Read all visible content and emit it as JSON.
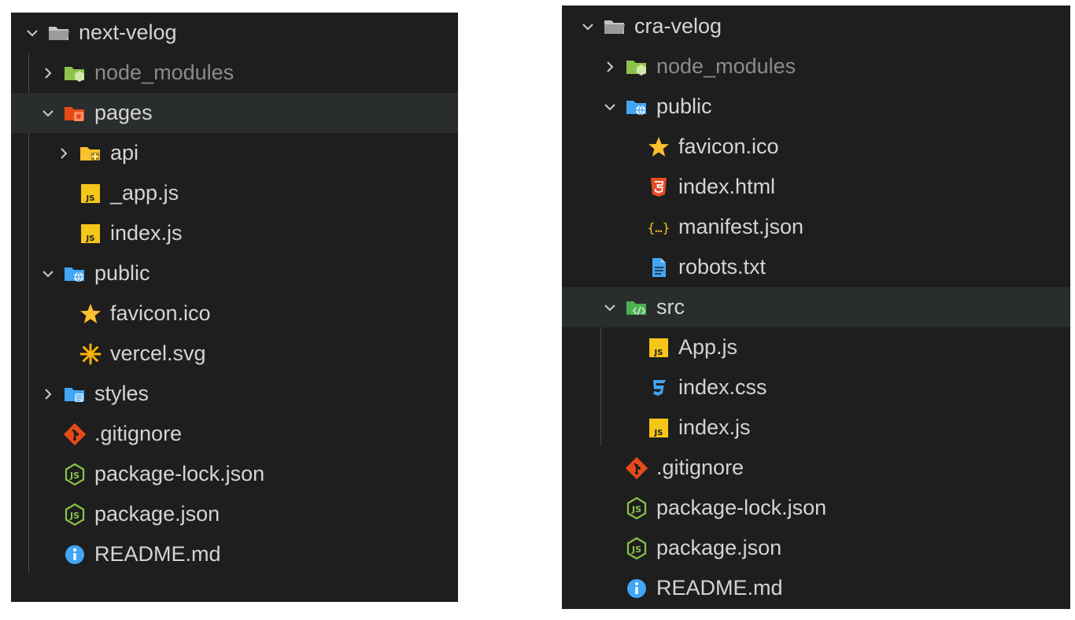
{
  "left": {
    "items": [
      {
        "label": "next-velog",
        "depth": 0,
        "twisty": "open",
        "icon": "folder-open-icon"
      },
      {
        "label": "node_modules",
        "depth": 1,
        "twisty": "closed",
        "icon": "node-folder-icon",
        "dim": true
      },
      {
        "label": "pages",
        "depth": 1,
        "twisty": "open",
        "icon": "pages-folder-icon",
        "selected": true
      },
      {
        "label": "api",
        "depth": 2,
        "twisty": "closed",
        "icon": "api-folder-icon"
      },
      {
        "label": "_app.js",
        "depth": 2,
        "twisty": "none",
        "icon": "js-file-icon"
      },
      {
        "label": "index.js",
        "depth": 2,
        "twisty": "none",
        "icon": "js-file-icon"
      },
      {
        "label": "public",
        "depth": 1,
        "twisty": "open",
        "icon": "public-folder-icon"
      },
      {
        "label": "favicon.ico",
        "depth": 2,
        "twisty": "none",
        "icon": "star-icon"
      },
      {
        "label": "vercel.svg",
        "depth": 2,
        "twisty": "none",
        "icon": "svg-file-icon"
      },
      {
        "label": "styles",
        "depth": 1,
        "twisty": "closed",
        "icon": "styles-folder-icon"
      },
      {
        "label": ".gitignore",
        "depth": 1,
        "twisty": "none",
        "icon": "git-icon"
      },
      {
        "label": "package-lock.json",
        "depth": 1,
        "twisty": "none",
        "icon": "node-js-icon"
      },
      {
        "label": "package.json",
        "depth": 1,
        "twisty": "none",
        "icon": "node-js-icon"
      },
      {
        "label": "README.md",
        "depth": 1,
        "twisty": "none",
        "icon": "info-icon"
      }
    ]
  },
  "right": {
    "items": [
      {
        "label": "cra-velog",
        "depth": 0,
        "twisty": "open",
        "icon": "folder-open-icon"
      },
      {
        "label": "node_modules",
        "depth": 1,
        "twisty": "closed",
        "icon": "node-folder-icon",
        "dim": true
      },
      {
        "label": "public",
        "depth": 1,
        "twisty": "open",
        "icon": "public-folder-icon"
      },
      {
        "label": "favicon.ico",
        "depth": 2,
        "twisty": "none",
        "icon": "star-icon"
      },
      {
        "label": "index.html",
        "depth": 2,
        "twisty": "none",
        "icon": "html5-icon"
      },
      {
        "label": "manifest.json",
        "depth": 2,
        "twisty": "none",
        "icon": "json-braces-icon"
      },
      {
        "label": "robots.txt",
        "depth": 2,
        "twisty": "none",
        "icon": "text-file-icon"
      },
      {
        "label": "src",
        "depth": 1,
        "twisty": "open",
        "icon": "src-folder-icon",
        "selected": true
      },
      {
        "label": "App.js",
        "depth": 2,
        "twisty": "none",
        "icon": "js-file-icon"
      },
      {
        "label": "index.css",
        "depth": 2,
        "twisty": "none",
        "icon": "css3-icon"
      },
      {
        "label": "index.js",
        "depth": 2,
        "twisty": "none",
        "icon": "js-file-icon"
      },
      {
        "label": ".gitignore",
        "depth": 1,
        "twisty": "none",
        "icon": "git-icon"
      },
      {
        "label": "package-lock.json",
        "depth": 1,
        "twisty": "none",
        "icon": "node-js-icon"
      },
      {
        "label": "package.json",
        "depth": 1,
        "twisty": "none",
        "icon": "node-js-icon"
      },
      {
        "label": "README.md",
        "depth": 1,
        "twisty": "none",
        "icon": "info-icon"
      }
    ]
  },
  "colors": {
    "panel_bg": "#1e1e1e",
    "selected_bg": "#2a2d2e",
    "text": "#d4d4d4",
    "dim_text": "#8b8b8b"
  }
}
